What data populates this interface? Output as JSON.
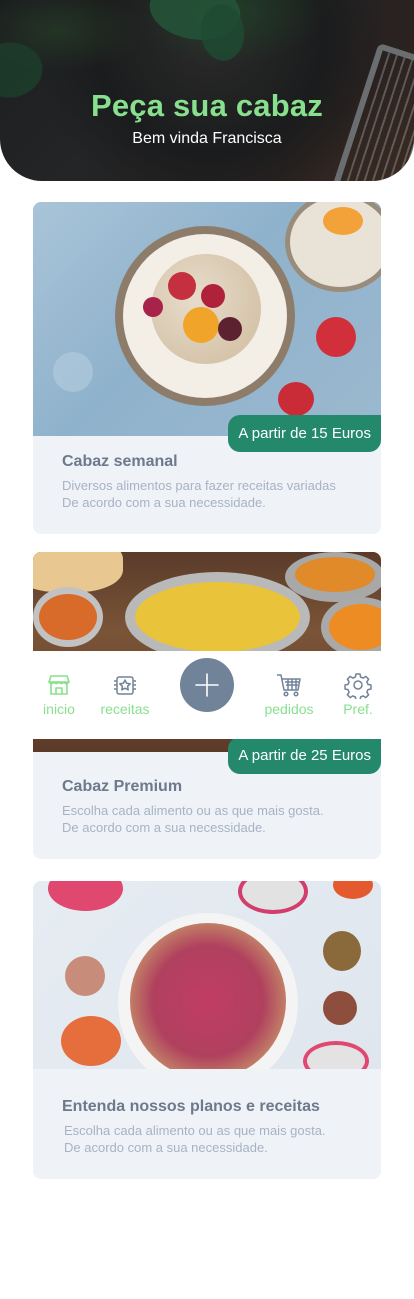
{
  "header": {
    "title": "Peça sua cabaz",
    "subtitle": "Bem vinda Francisca"
  },
  "cards": [
    {
      "title": "Cabaz semanal",
      "description": [
        "Diversos alimentos para fazer receitas variadas",
        "De acordo com a sua necessidade."
      ],
      "price_badge": "A partir de 15 Euros"
    },
    {
      "title": "Cabaz Premium",
      "description": [
        "Escolha cada alimento ou as que mais gosta.",
        "De acordo com a sua necessidade."
      ],
      "price_badge": "A partir de 25 Euros"
    },
    {
      "title": "Entenda nossos planos e receitas",
      "description": [
        "Escolha cada alimento ou as que mais gosta.",
        "De acordo com a sua necessidade."
      ]
    }
  ],
  "bottom_nav": {
    "items": [
      {
        "label": "inicio",
        "icon": "store-icon"
      },
      {
        "label": "receitas",
        "icon": "recipe-book-icon"
      },
      {
        "label": "",
        "icon": "plus-icon"
      },
      {
        "label": "pedidos",
        "icon": "shopping-cart-icon"
      },
      {
        "label": "Pref.",
        "icon": "gear-icon"
      }
    ]
  },
  "colors": {
    "accent_green": "#88e08e",
    "badge_green": "#24896b",
    "fab": "#718398",
    "card_bg": "#eff2f7"
  }
}
